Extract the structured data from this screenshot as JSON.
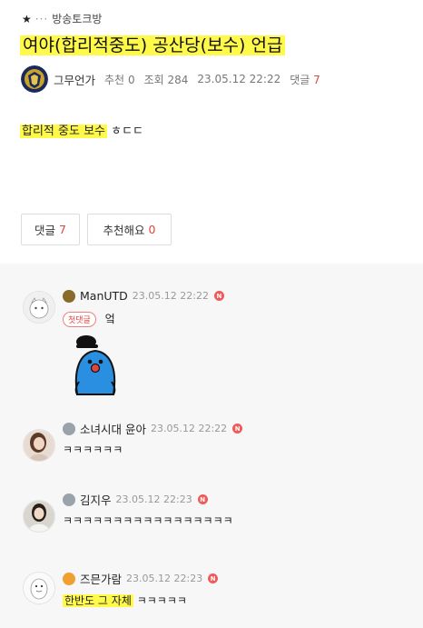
{
  "breadcrumb": {
    "star": "★",
    "dots": "···",
    "board": "방송토크방"
  },
  "post": {
    "title": "여야(합리적중도) 공산당(보수) 언급",
    "author": "그무언가",
    "recommend_label": "추천",
    "recommend_count": "0",
    "views_label": "조회",
    "views_count": "284",
    "datetime": "23.05.12 22:22",
    "comments_label": "댓글",
    "comments_count": "7",
    "body_highlight": "합리적 중도 보수",
    "body_rest": "ㅎㄷㄷ"
  },
  "buttons": {
    "comment_label": "댓글",
    "comment_count": "7",
    "recommend_label": "추천해요",
    "recommend_count": "0"
  },
  "comments": [
    {
      "author": "ManUTD",
      "date": "23.05.12 22:22",
      "new_badge": "N",
      "first_badge": "첫댓글",
      "text": "엌"
    },
    {
      "author": "소녀시대 윤아",
      "date": "23.05.12 22:22",
      "new_badge": "N",
      "text": "ㅋㅋㅋㅋㅋㅋ"
    },
    {
      "author": "김지우",
      "date": "23.05.12 22:23",
      "new_badge": "N",
      "text": "ㅋㅋㅋㅋㅋㅋㅋㅋㅋㅋㅋㅋㅋㅋㅋㅋㅋ"
    },
    {
      "author": "즈믄가람",
      "date": "23.05.12 22:23",
      "new_badge": "N",
      "text_highlight": "한반도 그 자체",
      "text_rest": "ㅋㅋㅋㅋㅋ"
    }
  ],
  "colors": {
    "highlight": "#fff94a",
    "accent_red": "#e0453e",
    "comment_bg": "#f7f7f7"
  },
  "icons": [
    "star-icon",
    "more-dots-icon",
    "author-avatar",
    "level-badge-icon",
    "new-badge-icon",
    "emoticon-sticker"
  ]
}
